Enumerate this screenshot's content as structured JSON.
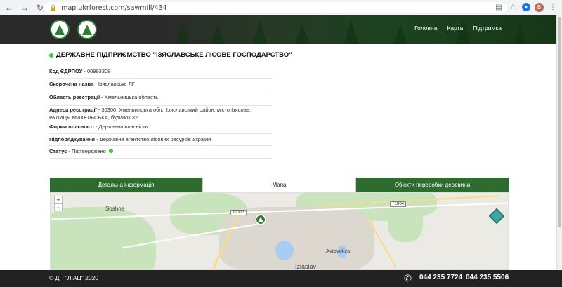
{
  "browser": {
    "url": "map.ukrforest.com/sawmill/434",
    "avatar_letter": "B"
  },
  "header": {
    "nav": [
      "Головна",
      "Карта",
      "Підтримка"
    ]
  },
  "company": {
    "title": "ДЕРЖАВНЕ ПІДПРИЄМСТВО \"ІЗЯСЛАВСЬКЕ ЛІСОВЕ ГОСПОДАРСТВО\"",
    "fields": [
      {
        "label": "Код ЄДРПОУ",
        "value": "00993308"
      },
      {
        "label": "Скорочена назва",
        "value": "Ізяславське ЛГ"
      },
      {
        "label": "Область реєстрації",
        "value": "Хмельницька область"
      },
      {
        "label": "Адреса реєстрації",
        "value": "30300, Хмельницька обл., Ізяславський район, місто Ізяслав, ВУЛИЦЯ МИХЕЛЬСЬКА, будинок 32"
      },
      {
        "label": "Форма власності",
        "value": "Державна власність"
      },
      {
        "label": "Підпорядкування",
        "value": "Державне агентство лісових ресурсів України"
      },
      {
        "label": "Статус",
        "value": "Підтверджено"
      }
    ],
    "status_color": "#2ecc40"
  },
  "tabs": [
    {
      "label": "Детальна інформація",
      "active": false
    },
    {
      "label": "Мапа",
      "active": true
    },
    {
      "label": "Об'єкти переробки деревини",
      "active": false
    }
  ],
  "map": {
    "zoom_in": "+",
    "zoom_out": "−",
    "labels": {
      "soshne": "Soshne",
      "avtovokzal": "Avtovokzal",
      "iziaslav": "Iziaslav"
    },
    "road_badges": [
      "T2313",
      "T1804"
    ]
  },
  "footer": {
    "copyright": "© ДП \"ЛІАЦ\" 2020",
    "phones": [
      "044 235 7724",
      "044 235 5506"
    ]
  },
  "colors": {
    "brand_green": "#2e6b2f",
    "header_dark": "#2a2a2a"
  }
}
